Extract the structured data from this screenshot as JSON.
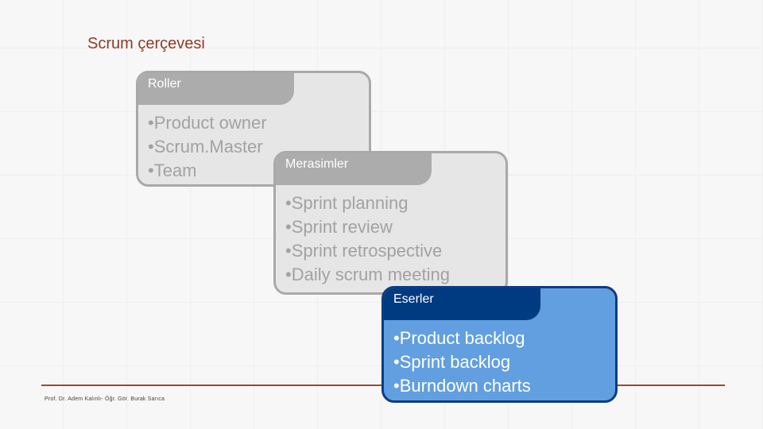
{
  "slide": {
    "title": "Scrum çerçevesi",
    "footer": "Prof. Dr. Adem Kalınlı- Öğr. Gör. Burak Sarıca",
    "boxes": [
      {
        "header": "Roller",
        "items": [
          "•Product owner",
          "•Scrum.Master",
          "•Team"
        ]
      },
      {
        "header": "Merasimler",
        "items": [
          "•Sprint planning",
          "•Sprint review",
          "•Sprint retrospective",
          "•Daily scrum meeting"
        ]
      },
      {
        "header": "Eserler",
        "items": [
          "•Product backlog",
          "•Sprint backlog",
          "•Burndown charts"
        ]
      }
    ],
    "colors": {
      "title": "#8e3b27",
      "rule": "#9a4a35",
      "inactive_header": "#acacac",
      "active_header": "#003b82",
      "active_body": "#619fe0"
    }
  }
}
